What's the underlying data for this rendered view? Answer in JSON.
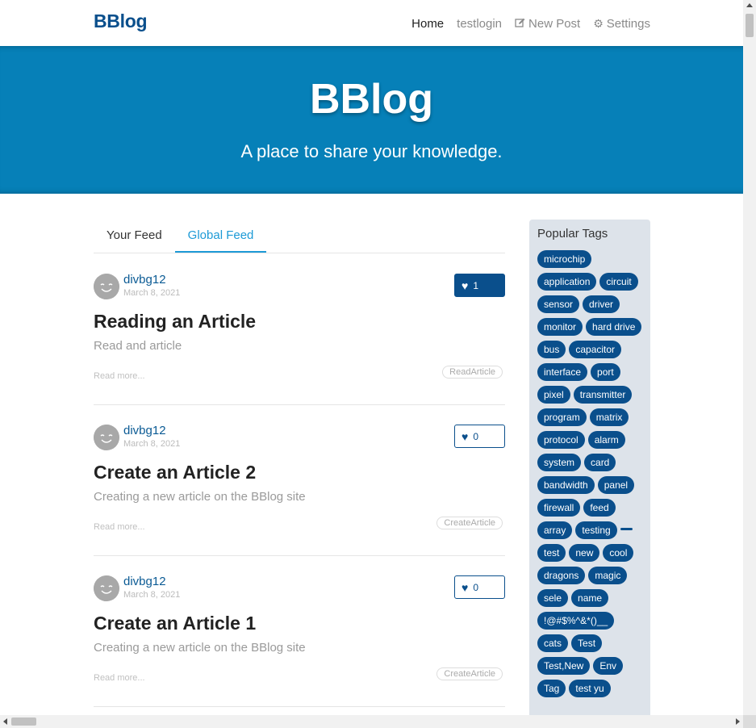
{
  "nav": {
    "brand": "BBlog",
    "links": [
      {
        "label": "Home",
        "icon": ""
      },
      {
        "label": "testlogin",
        "icon": ""
      },
      {
        "label": "New Post",
        "icon": "edit-icon"
      },
      {
        "label": "Settings",
        "icon": "gear-icon"
      }
    ]
  },
  "banner": {
    "title": "BBlog",
    "subtitle": "A place to share your knowledge."
  },
  "feed": {
    "tabs": [
      "Your Feed",
      "Global Feed"
    ],
    "active_tab": "Global Feed"
  },
  "articles": [
    {
      "author": "divbg12",
      "date": "March 8, 2021",
      "favorites": "1",
      "favorited": true,
      "title": "Reading an Article",
      "description": "Read and article",
      "read_more": "Read more...",
      "tag": "ReadArticle"
    },
    {
      "author": "divbg12",
      "date": "March 8, 2021",
      "favorites": "0",
      "favorited": false,
      "title": "Create an Article 2",
      "description": "Creating a new article on the BBlog site",
      "read_more": "Read more...",
      "tag": "CreateArticle"
    },
    {
      "author": "divbg12",
      "date": "March 8, 2021",
      "favorites": "0",
      "favorited": false,
      "title": "Create an Article 1",
      "description": "Creating a new article on the BBlog site",
      "read_more": "Read more...",
      "tag": "CreateArticle"
    }
  ],
  "sidebar": {
    "title": "Popular Tags",
    "tags": [
      "microchip",
      "application",
      "circuit",
      "sensor",
      "driver",
      "monitor",
      "hard drive",
      "bus",
      "capacitor",
      "interface",
      "port",
      "pixel",
      "transmitter",
      "program",
      "matrix",
      "protocol",
      "alarm",
      "system",
      "card",
      "bandwidth",
      "panel",
      "firewall",
      "feed",
      "array",
      "testing",
      "",
      "test",
      "new",
      "cool",
      "dragons",
      "magic",
      "sele",
      "name",
      "!@#$%^&*()__",
      "cats",
      "Test",
      "Test,New",
      "Env",
      "Tag",
      "test yu"
    ]
  },
  "colors": {
    "brand": "#0a4f8c",
    "banner": "#0680b8",
    "tab_active": "#1d9ad6",
    "sidebar_bg": "#dde3ea"
  }
}
